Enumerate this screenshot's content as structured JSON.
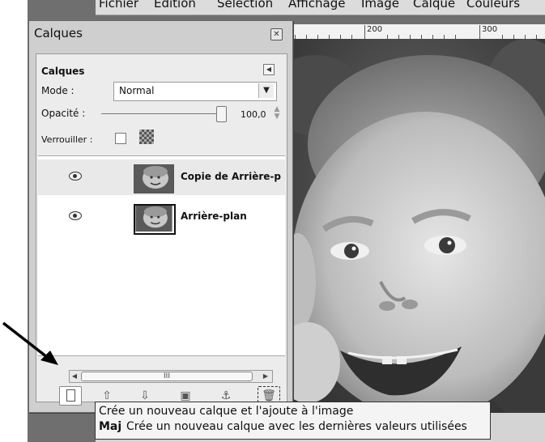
{
  "menubar": {
    "items": [
      "Fichier",
      "Édition",
      "Sélection",
      "Affichage",
      "Image",
      "Calque",
      "Couleurs"
    ]
  },
  "ruler": {
    "labels": [
      "200",
      "300"
    ]
  },
  "dock": {
    "title": "Calques",
    "close_icon": "close-icon",
    "tab_label": "Calques",
    "mode": {
      "label": "Mode :",
      "value": "Normal"
    },
    "opacity": {
      "label": "Opacité :",
      "value": "100,0",
      "percent": 100
    },
    "lock": {
      "label": "Verrouiller :",
      "checked": false
    },
    "layers": [
      {
        "name": "Copie de Arrière-p",
        "visible": true,
        "selected": true
      },
      {
        "name": "Arrière-plan",
        "visible": true,
        "selected": false
      }
    ],
    "scrollbar": {
      "thumb_label": "III"
    },
    "toolbar": {
      "new_layer_icon": "new-layer-icon",
      "raise_icon": "arrow-up-icon",
      "lower_icon": "arrow-down-icon",
      "duplicate_icon": "duplicate-icon",
      "anchor_icon": "anchor-icon",
      "delete_icon": "trash-icon"
    }
  },
  "tooltip": {
    "line1": "Crée un nouveau calque et l'ajoute à l'image",
    "modifier": "Maj",
    "line2": "Crée un nouveau calque avec les dernières valeurs utilisées"
  },
  "colors": {
    "dock_bg": "#cfcfcf",
    "panel_bg": "#ececec",
    "tooltip_bg": "#f4f4f4"
  }
}
